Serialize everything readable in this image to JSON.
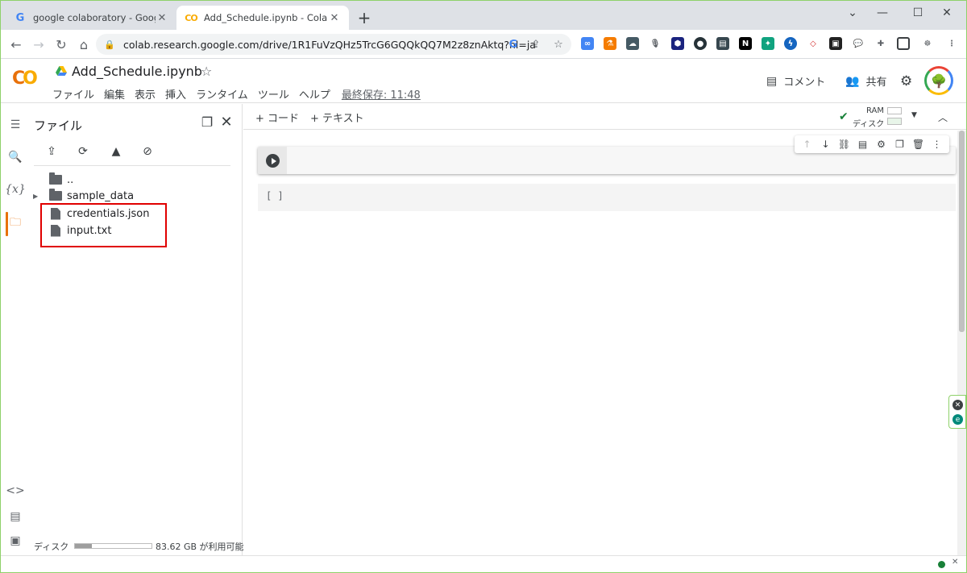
{
  "browser": {
    "tabs": [
      {
        "title": "google colaboratory - Google 検",
        "favicon": "G",
        "favicon_color": "#4285f4"
      },
      {
        "title": "Add_Schedule.ipynb - Colaborato",
        "favicon": "CO",
        "favicon_color": "#f9ab00"
      }
    ],
    "new_tab_label": "+",
    "window": {
      "minimize": "—",
      "maximize": "☐",
      "close": "✕",
      "dropdown": "⌄"
    },
    "url": "colab.research.google.com/drive/1R1FuVzQHz5TrcG6GQQkQQ7M2z8znAktq?hl=ja"
  },
  "colab": {
    "logo": "CO",
    "notebook_title": "Add_Schedule.ipynb",
    "menu": [
      "ファイル",
      "編集",
      "表示",
      "挿入",
      "ランタイム",
      "ツール",
      "ヘルプ"
    ],
    "last_saved": "最終保存: 11:48",
    "comment_label": "コメント",
    "share_label": "共有"
  },
  "files_panel": {
    "title": "ファイル",
    "tree": [
      {
        "name": "..",
        "kind": "parent"
      },
      {
        "name": "sample_data",
        "kind": "folder"
      },
      {
        "name": "credentials.json",
        "kind": "file"
      },
      {
        "name": "input.txt",
        "kind": "file"
      }
    ],
    "disk_label": "ディスク",
    "disk_free": "83.62 GB が利用可能",
    "disk_used_fraction": 0.22
  },
  "notebook": {
    "add_code": "+ コード",
    "add_text": "+ テキスト",
    "ram_label": "RAM",
    "disk_label": "ディスク",
    "output_prompt": "[ ]"
  },
  "colors": {
    "accent": "#e8710a",
    "highlight_box": "#e00000",
    "connected": "#188038"
  }
}
